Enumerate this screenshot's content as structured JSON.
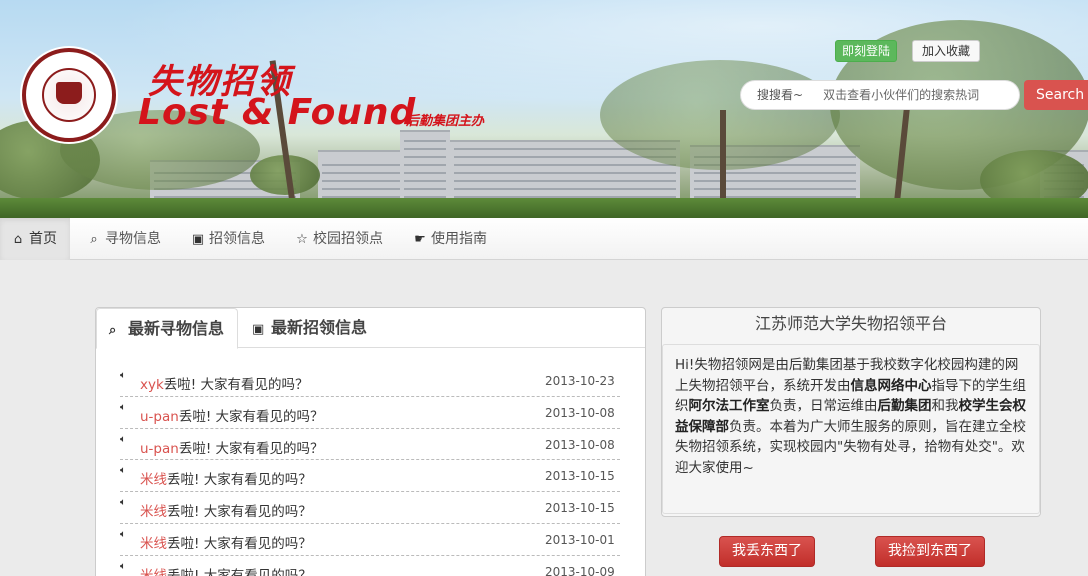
{
  "header": {
    "title_cn": "失物招领",
    "title_en": "Lost & Found",
    "subtitle": "后勤集团主办",
    "login_label": "即刻登陆",
    "favorite_label": "加入收藏",
    "search_label": "搜搜看~",
    "search_placeholder": "双击查看小伙伴们的搜索热词",
    "search_button": "Search"
  },
  "nav": {
    "items": [
      {
        "label": "首页",
        "icon": "home-icon"
      },
      {
        "label": "寻物信息",
        "icon": "search-icon"
      },
      {
        "label": "招领信息",
        "icon": "picture-icon"
      },
      {
        "label": "校园招领点",
        "icon": "star-icon"
      },
      {
        "label": "使用指南",
        "icon": "hand-pointer-icon"
      }
    ]
  },
  "left_panel": {
    "tabs": [
      {
        "label": "最新寻物信息",
        "icon": "search-icon"
      },
      {
        "label": "最新招领信息",
        "icon": "picture-icon"
      }
    ],
    "items": [
      {
        "user": "xyk",
        "text": "丢啦! 大家有看见的吗？",
        "date": "2013-10-23"
      },
      {
        "user": "u-pan",
        "text": "丢啦! 大家有看见的吗？",
        "date": "2013-10-08"
      },
      {
        "user": "u-pan",
        "text": "丢啦! 大家有看见的吗？",
        "date": "2013-10-08"
      },
      {
        "user": "米线",
        "text": "丢啦! 大家有看见的吗？",
        "date": "2013-10-15"
      },
      {
        "user": "米线",
        "text": "丢啦! 大家有看见的吗？",
        "date": "2013-10-15"
      },
      {
        "user": "米线",
        "text": "丢啦! 大家有看见的吗？",
        "date": "2013-10-01"
      },
      {
        "user": "米线",
        "text": "丢啦! 大家有看见的吗？",
        "date": "2013-10-09"
      }
    ]
  },
  "right_panel": {
    "title": "江苏师范大学失物招领平台",
    "p1": "Hi!失物招领网是由后勤集团基于我校数字化校园构建的网上失物招领平台，系统开发由",
    "b1": "信息网络中心",
    "p2": "指导下的学生组织",
    "b2": "阿尔法工作室",
    "p3": "负责，日常运维由",
    "b3": "后勤集团",
    "p4": "和我",
    "b4": "校学生会权益保障部",
    "p5": "负责。本着为广大师生服务的原则，旨在建立全校失物招领系统，实现校园内\"失物有处寻，拾物有处交\"。欢迎大家使用~",
    "lost_button": "我丢东西了",
    "found_button": "我捡到东西了"
  },
  "colors": {
    "brand_red": "#d4141b",
    "accent_red": "#d9534f",
    "login_green": "#5cb85c"
  }
}
